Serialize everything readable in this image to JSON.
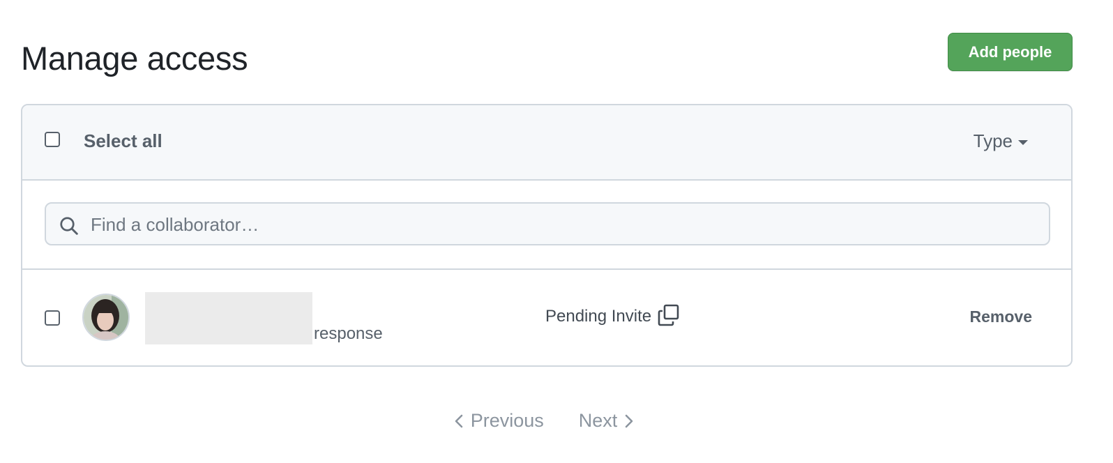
{
  "header": {
    "title": "Manage access",
    "add_button_label": "Add people"
  },
  "panel": {
    "select_all_label": "Select all",
    "type_filter_label": "Type",
    "search_placeholder": "Find a collaborator…"
  },
  "members": [
    {
      "name_suffix": "response",
      "status": "Pending Invite",
      "action_label": "Remove"
    }
  ],
  "pagination": {
    "previous_label": "Previous",
    "next_label": "Next"
  },
  "icons": {
    "search": "search-icon",
    "copy": "copy-icon",
    "caret": "caret-down-icon",
    "prev": "chevron-left-icon",
    "next": "chevron-right-icon"
  },
  "colors": {
    "primary_button": "#54a45a",
    "border": "#d0d7de",
    "header_bg": "#f6f8fa",
    "muted_text": "#57606a"
  }
}
